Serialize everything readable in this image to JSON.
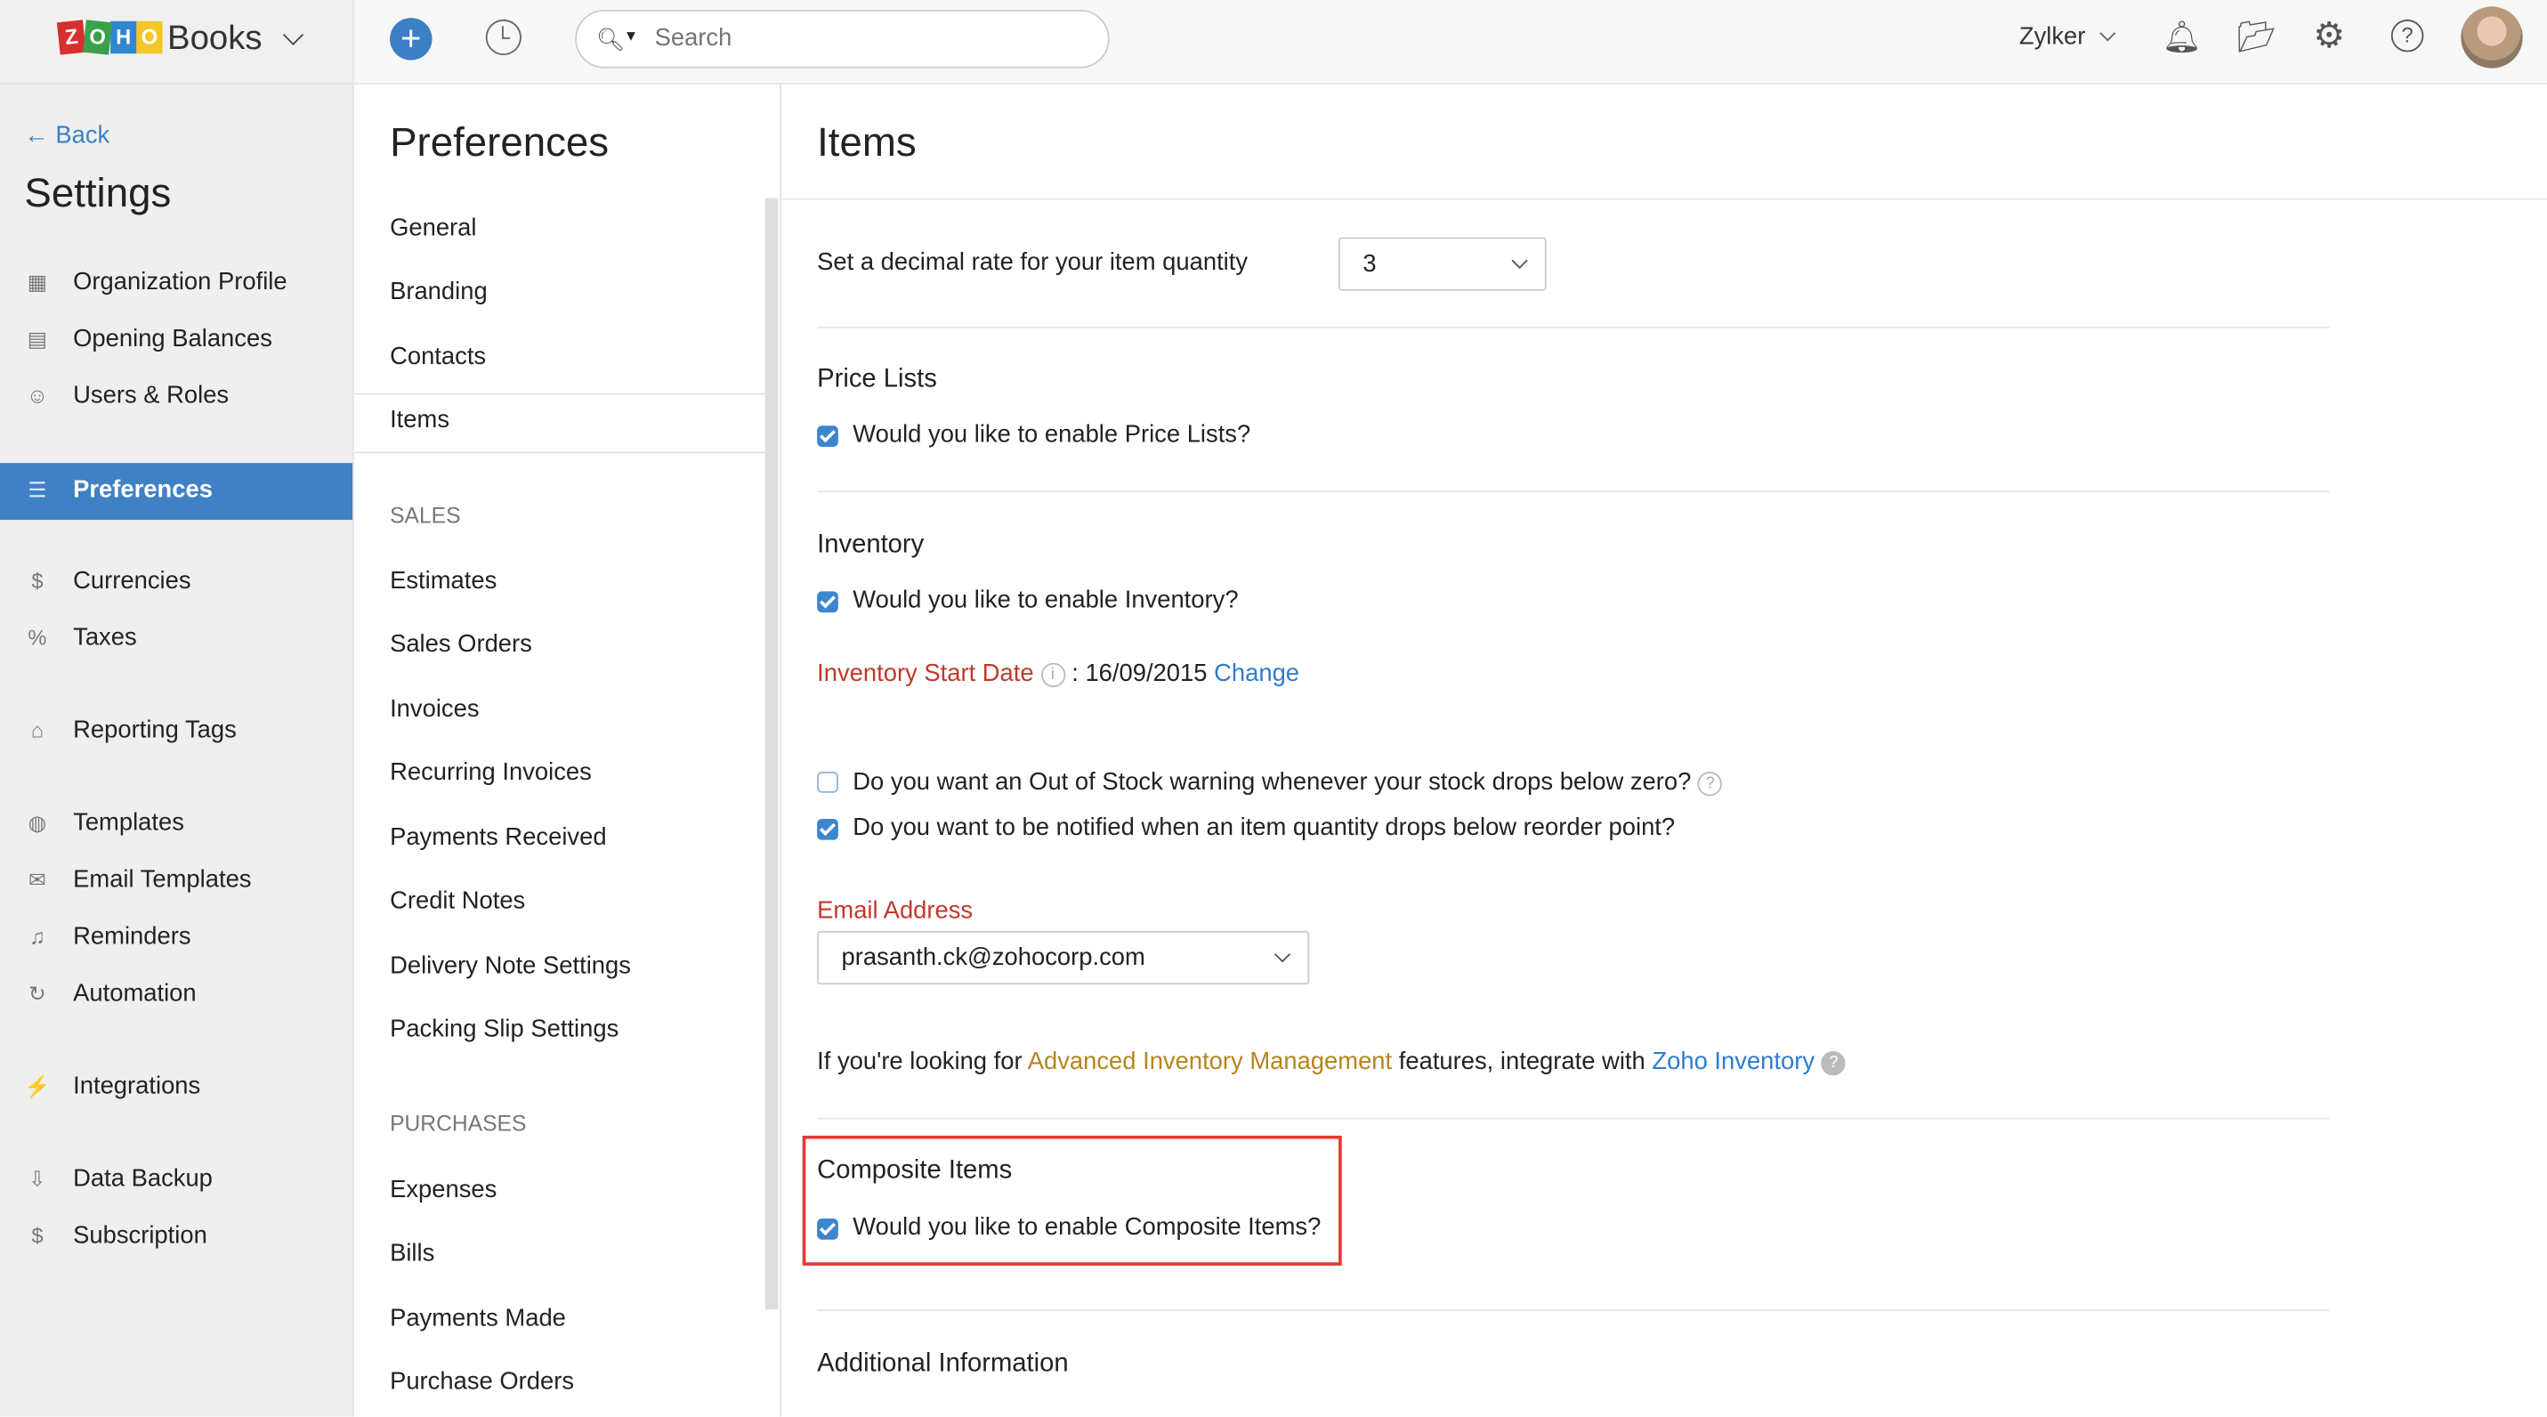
{
  "app": {
    "brand": "Books",
    "logo_text": "ZOHO",
    "search_placeholder": "Search",
    "org": "Zylker"
  },
  "colors": {
    "accent": "#4080c4",
    "red_label": "#c0392b",
    "link": "#2f7bd1",
    "orange_link": "#b5851d",
    "highlight_box": "#e53935"
  },
  "sidebar": {
    "back": "Back",
    "title": "Settings",
    "items": [
      {
        "label": "Organization Profile",
        "icon": "building-icon"
      },
      {
        "label": "Opening Balances",
        "icon": "ledger-icon"
      },
      {
        "label": "Users & Roles",
        "icon": "users-icon"
      },
      {
        "label": "Preferences",
        "icon": "sliders-icon",
        "active": true
      },
      {
        "label": "Currencies",
        "icon": "currency-icon"
      },
      {
        "label": "Taxes",
        "icon": "percent-icon"
      },
      {
        "label": "Reporting Tags",
        "icon": "tag-icon"
      },
      {
        "label": "Templates",
        "icon": "palette-icon"
      },
      {
        "label": "Email Templates",
        "icon": "email-icon"
      },
      {
        "label": "Reminders",
        "icon": "bell-icon"
      },
      {
        "label": "Automation",
        "icon": "refresh-icon"
      },
      {
        "label": "Integrations",
        "icon": "plug-icon"
      },
      {
        "label": "Data Backup",
        "icon": "backup-icon"
      },
      {
        "label": "Subscription",
        "icon": "subscription-icon"
      }
    ]
  },
  "preferences": {
    "title": "Preferences",
    "general": [
      "General",
      "Branding",
      "Contacts",
      "Items"
    ],
    "selected": "Items",
    "sales_heading": "SALES",
    "sales": [
      "Estimates",
      "Sales Orders",
      "Invoices",
      "Recurring Invoices",
      "Payments Received",
      "Credit Notes",
      "Delivery Note Settings",
      "Packing Slip Settings"
    ],
    "purchases_heading": "PURCHASES",
    "purchases": [
      "Expenses",
      "Bills",
      "Payments Made",
      "Purchase Orders"
    ]
  },
  "main": {
    "title": "Items",
    "decimal_label": "Set a decimal rate for your item quantity",
    "decimal_value": "3",
    "price_lists": {
      "title": "Price Lists",
      "checkbox": "Would you like to enable Price Lists?",
      "checked": true
    },
    "inventory": {
      "title": "Inventory",
      "checkbox": "Would you like to enable Inventory?",
      "checked": true,
      "start_date_label": "Inventory Start Date",
      "start_date_value": ": 16/09/2015",
      "change": "Change",
      "out_of_stock": "Do you want an Out of Stock warning whenever your stock drops below zero?",
      "out_of_stock_checked": false,
      "reorder": "Do you want to be notified when an item quantity drops below reorder point?",
      "reorder_checked": true,
      "email_label": "Email Address",
      "email_value": "prasanth.ck@zohocorp.com",
      "info_prefix": "If you're looking for",
      "info_link1": "Advanced Inventory Management",
      "info_mid": "features, integrate with",
      "info_link2": "Zoho Inventory"
    },
    "composite": {
      "title": "Composite Items",
      "checkbox": "Would you like to enable Composite Items?",
      "checked": true
    },
    "additional": {
      "title": "Additional Information"
    }
  }
}
